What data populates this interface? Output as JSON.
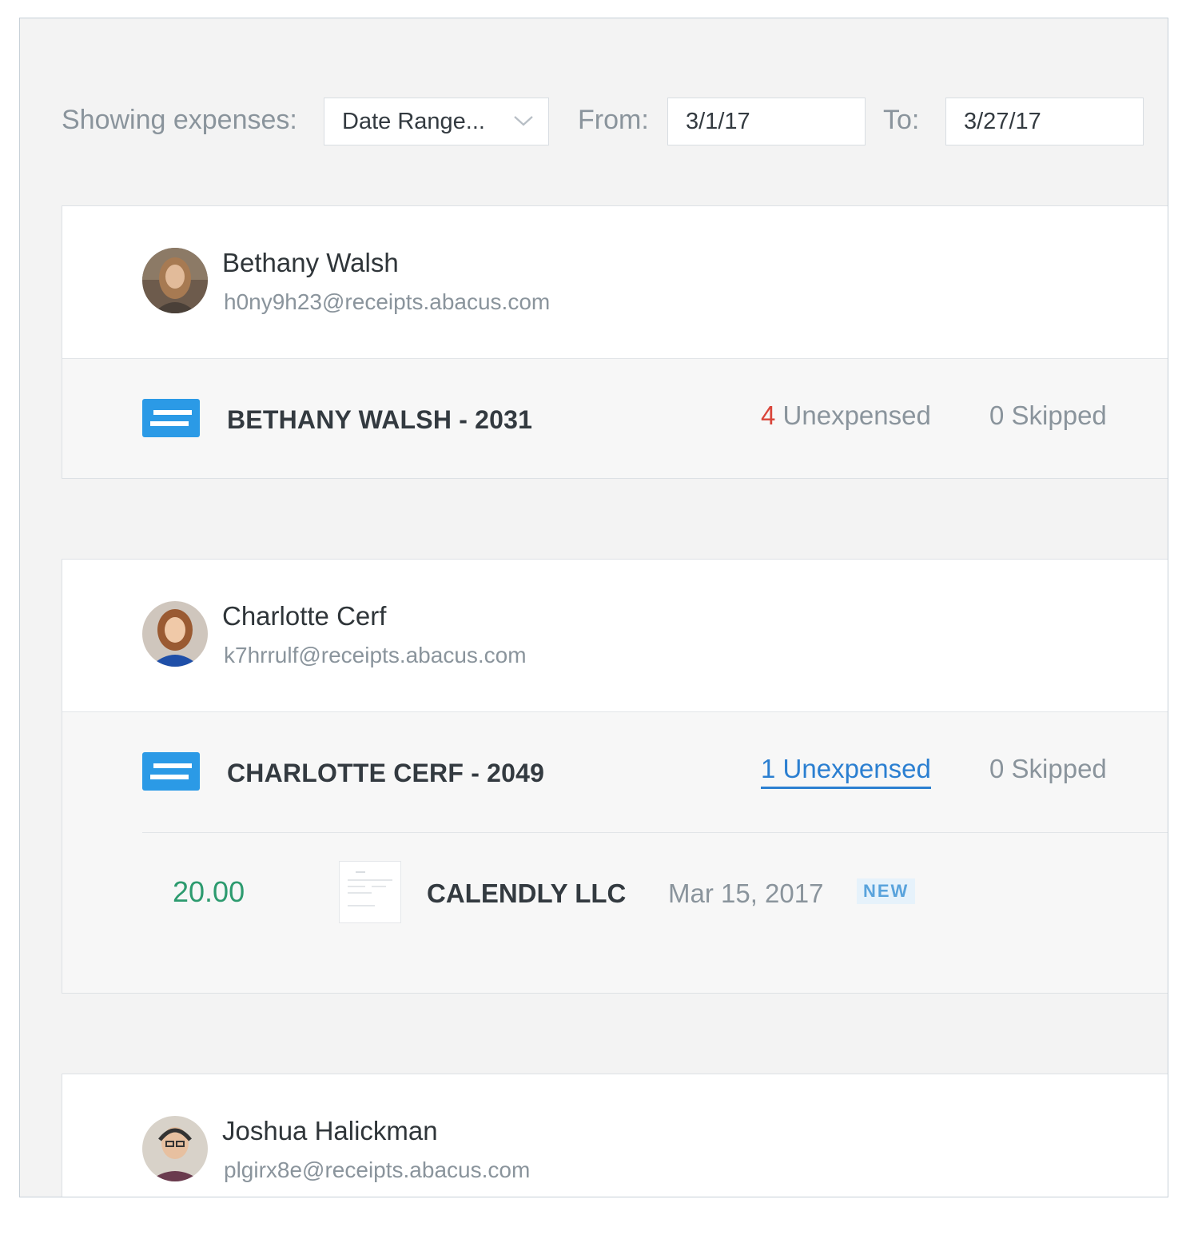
{
  "filter": {
    "label": "Showing expenses:",
    "range_value": "Date Range...",
    "from_label": "From:",
    "from_value": "3/1/17",
    "to_label": "To:",
    "to_value": "3/27/17"
  },
  "users": [
    {
      "name": "Bethany Walsh",
      "email": "h0ny9h23@receipts.abacus.com",
      "card": {
        "name": "BETHANY WALSH - 2031",
        "unexpensed_count": "4",
        "unexpensed_label": " Unexpensed",
        "skipped": "0 Skipped"
      }
    },
    {
      "name": "Charlotte Cerf",
      "email": "k7hrrulf@receipts.abacus.com",
      "card": {
        "name": "CHARLOTTE CERF - 2049",
        "unexpensed_count": "1",
        "unexpensed_label": " Unexpensed",
        "skipped": "0 Skipped"
      },
      "transactions": [
        {
          "amount": "20.00",
          "merchant": "CALENDLY LLC",
          "date": "Mar 15, 2017",
          "badge": "NEW"
        }
      ]
    },
    {
      "name": "Joshua Halickman",
      "email": "plgirx8e@receipts.abacus.com"
    }
  ],
  "colors": {
    "accent_blue": "#2b7fd1",
    "card_icon_blue": "#2b9ae6",
    "alert_red": "#d9453a",
    "amount_green": "#2d9b6f",
    "badge_bg": "#e6f2fb"
  },
  "icons": {
    "dropdown": "chevron-down-icon",
    "card": "credit-card-icon"
  }
}
